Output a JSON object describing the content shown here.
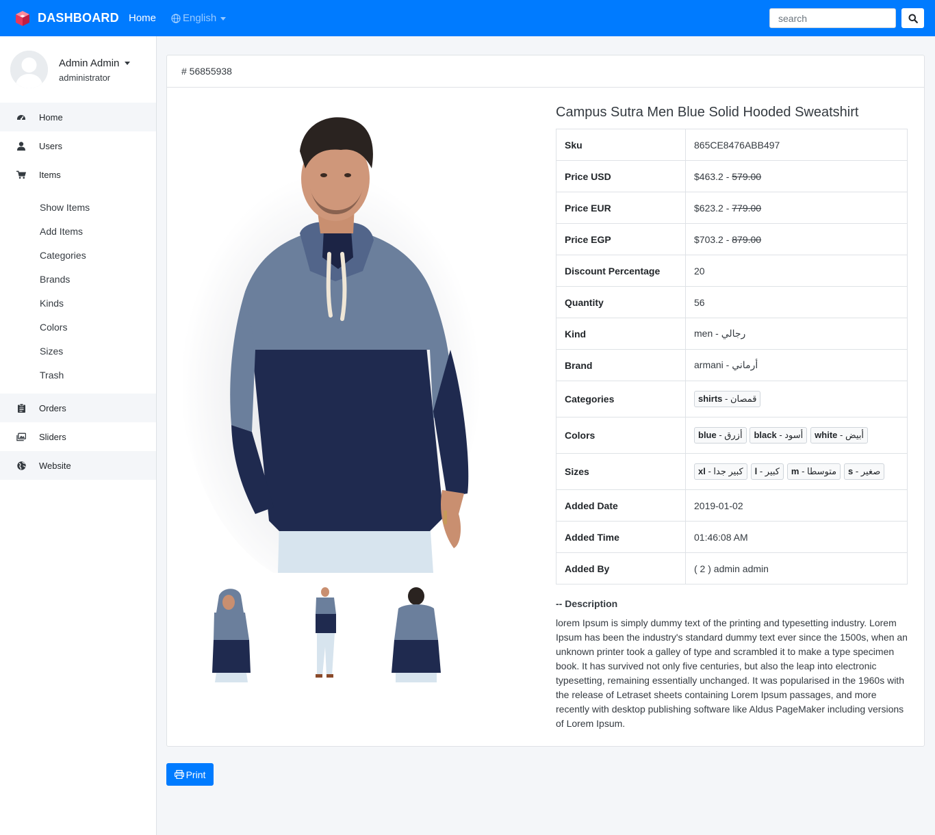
{
  "navbar": {
    "brand": "DASHBOARD",
    "home": "Home",
    "language": "English",
    "search_placeholder": "search"
  },
  "sidebar": {
    "user_name": "Admin Admin",
    "user_role": "administrator",
    "items": [
      {
        "label": "Home",
        "icon": "dashboard-icon"
      },
      {
        "label": "Users",
        "icon": "user-icon"
      },
      {
        "label": "Items",
        "icon": "cart-icon"
      }
    ],
    "sub_items": [
      "Show Items",
      "Add Items",
      "Categories",
      "Brands",
      "Kinds",
      "Colors",
      "Sizes",
      "Trash"
    ],
    "bottom_items": [
      {
        "label": "Orders",
        "icon": "clipboard-icon"
      },
      {
        "label": "Sliders",
        "icon": "images-icon"
      },
      {
        "label": "Website",
        "icon": "globe-icon"
      }
    ]
  },
  "card": {
    "header": "# 56855938"
  },
  "product": {
    "title": "Campus Sutra Men Blue Solid Hooded Sweatshirt",
    "sku_label": "Sku",
    "sku": "865CE8476ABB497",
    "price_usd_label": "Price USD",
    "price_usd": "$463.2 - ",
    "price_usd_old": "579.00",
    "price_eur_label": "Price EUR",
    "price_eur": "$623.2 - ",
    "price_eur_old": "779.00",
    "price_egp_label": "Price EGP",
    "price_egp": "$703.2 - ",
    "price_egp_old": "879.00",
    "discount_label": "Discount Percentage",
    "discount": "20",
    "quantity_label": "Quantity",
    "quantity": "56",
    "kind_label": "Kind",
    "kind": "men - رجالي",
    "brand_label": "Brand",
    "brand": "armani - أرماني",
    "categories_label": "Categories",
    "categories": [
      {
        "en": "shirts",
        "ar": "قمصان"
      }
    ],
    "colors_label": "Colors",
    "colors": [
      {
        "en": "blue",
        "ar": "أزرق"
      },
      {
        "en": "black",
        "ar": "أسود"
      },
      {
        "en": "white",
        "ar": "أبيض"
      }
    ],
    "sizes_label": "Sizes",
    "sizes": [
      {
        "en": "xl",
        "ar": "كبير جدا"
      },
      {
        "en": "l",
        "ar": "كبير"
      },
      {
        "en": "m",
        "ar": "متوسطا"
      },
      {
        "en": "s",
        "ar": "صغير"
      }
    ],
    "added_date_label": "Added Date",
    "added_date": "2019-01-02",
    "added_time_label": "Added Time",
    "added_time": "01:46:08 AM",
    "added_by_label": "Added By",
    "added_by": "( 2 ) admin admin",
    "description_title": "-- Description",
    "description": "lorem Ipsum is simply dummy text of the printing and typesetting industry. Lorem Ipsum has been the industry's standard dummy text ever since the 1500s, when an unknown printer took a galley of type and scrambled it to make a type specimen book. It has survived not only five centuries, but also the leap into electronic typesetting, remaining essentially unchanged. It was popularised in the 1960s with the release of Letraset sheets containing Lorem Ipsum passages, and more recently with desktop publishing software like Aldus PageMaker including versions of Lorem Ipsum."
  },
  "print_label": "Print",
  "colors": {
    "primary": "#007bff",
    "hoodie_top": "#6b7f9c",
    "hoodie_bottom": "#1f2a4f"
  }
}
